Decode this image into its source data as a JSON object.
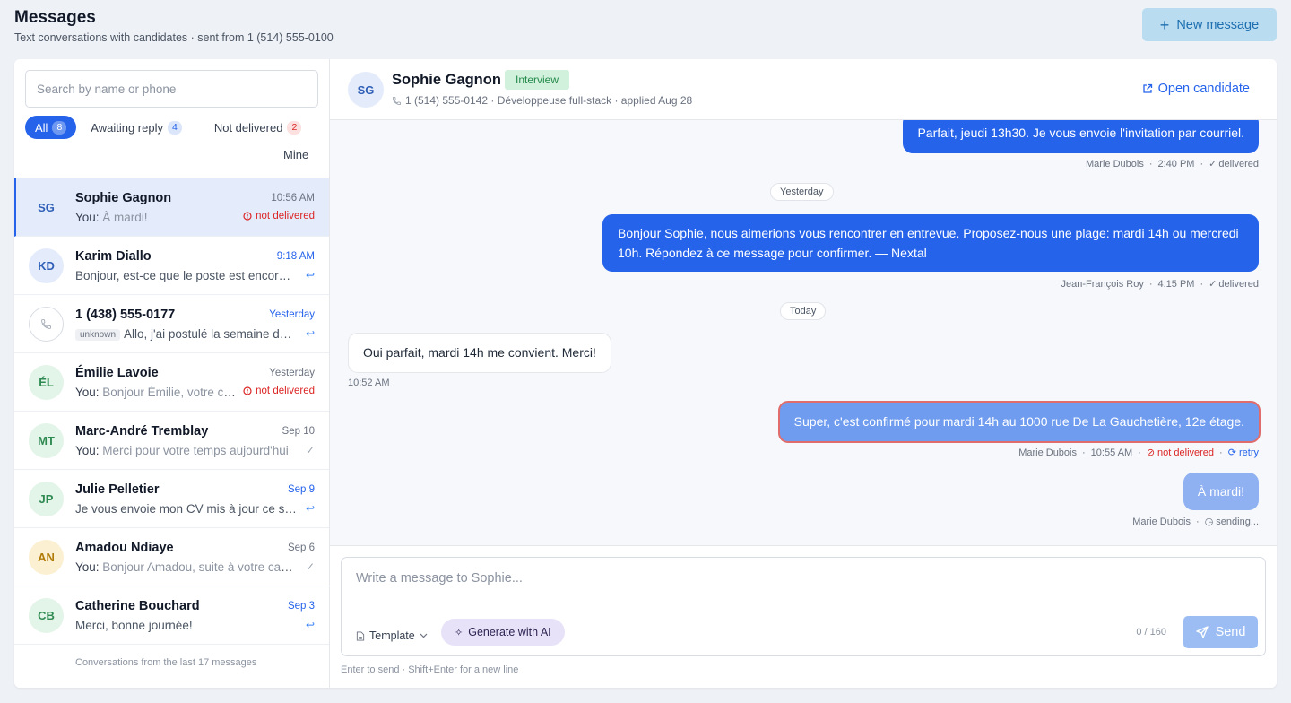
{
  "header": {
    "title": "Messages",
    "subtitle": "Text conversations with candidates · sent from 1 (514) 555-0100",
    "new_message": "New message"
  },
  "sidebar": {
    "search_placeholder": "Search by name or phone",
    "filters": [
      {
        "label": "All",
        "count": "8"
      },
      {
        "label": "Awaiting reply",
        "count": "4"
      },
      {
        "label": "Not delivered",
        "count": "2"
      },
      {
        "label": "Mine"
      }
    ],
    "conversations": [
      {
        "initials": "SG",
        "name": "Sophie Gagnon",
        "time": "10:56 AM",
        "you": "You:",
        "preview": " À mardi!",
        "status": "not delivered"
      },
      {
        "initials": "KD",
        "name": "Karim Diallo",
        "time": "9:18 AM",
        "preview": "Bonjour, est-ce que le poste est encore disponible?"
      },
      {
        "name": "1 (438) 555-0177",
        "time": "Yesterday",
        "tag": "unknown",
        "preview": "Allo, j'ai postulé la semaine dernière"
      },
      {
        "initials": "ÉL",
        "name": "Émilie Lavoie",
        "time": "Yesterday",
        "you": "You:",
        "preview": " Bonjour Émilie, votre candidature",
        "status": "not delivered"
      },
      {
        "initials": "MT",
        "name": "Marc-André Tremblay",
        "time": "Sep 10",
        "you": "You:",
        "preview": " Merci pour votre temps aujourd'hui"
      },
      {
        "initials": "JP",
        "name": "Julie Pelletier",
        "time": "Sep 9",
        "preview": "Je vous envoie mon CV mis à jour ce soir"
      },
      {
        "initials": "AN",
        "name": "Amadou Ndiaye",
        "time": "Sep 6",
        "you": "You:",
        "preview": " Bonjour Amadou, suite à votre candidature"
      },
      {
        "initials": "CB",
        "name": "Catherine Bouchard",
        "time": "Sep 3",
        "preview": "Merci, bonne journée!"
      }
    ],
    "footer": "Conversations from the last 17 messages"
  },
  "chat": {
    "initials": "SG",
    "name": "Sophie Gagnon",
    "stage": "Interview",
    "meta": "1 (514) 555-0142 · Développeuse full-stack · applied Aug 28",
    "open_candidate": "Open candidate",
    "messages": [
      {
        "text": "Parfait, jeudi 13h30. Je vous envoie l'invitation par courriel.",
        "sender": "Marie Dubois",
        "time": "2:40 PM",
        "status": "delivered"
      },
      {
        "day": "Yesterday"
      },
      {
        "text": "Bonjour Sophie, nous aimerions vous rencontrer en entrevue. Proposez-nous une plage: mardi 14h ou mercredi 10h. Répondez à ce message pour confirmer. — Nextal",
        "sender": "Jean-François Roy",
        "time": "4:15 PM",
        "status": "delivered"
      },
      {
        "day": "Today"
      },
      {
        "text": "Oui parfait, mardi 14h me convient. Merci!",
        "time": "10:52 AM"
      },
      {
        "text": "Super, c'est confirmé pour mardi 14h au 1000 rue De La Gauchetière, 12e étage.",
        "sender": "Marie Dubois",
        "time": "10:55 AM",
        "status": "not delivered",
        "action": "retry"
      },
      {
        "text": "À mardi!",
        "sender": "Marie Dubois",
        "status": "sending..."
      }
    ]
  },
  "composer": {
    "placeholder": "Write a message to Sophie...",
    "template": "Template",
    "ai": "Generate with AI",
    "count": "0 / 160",
    "send": "Send",
    "hint": "Enter to send · Shift+Enter for a new line"
  }
}
